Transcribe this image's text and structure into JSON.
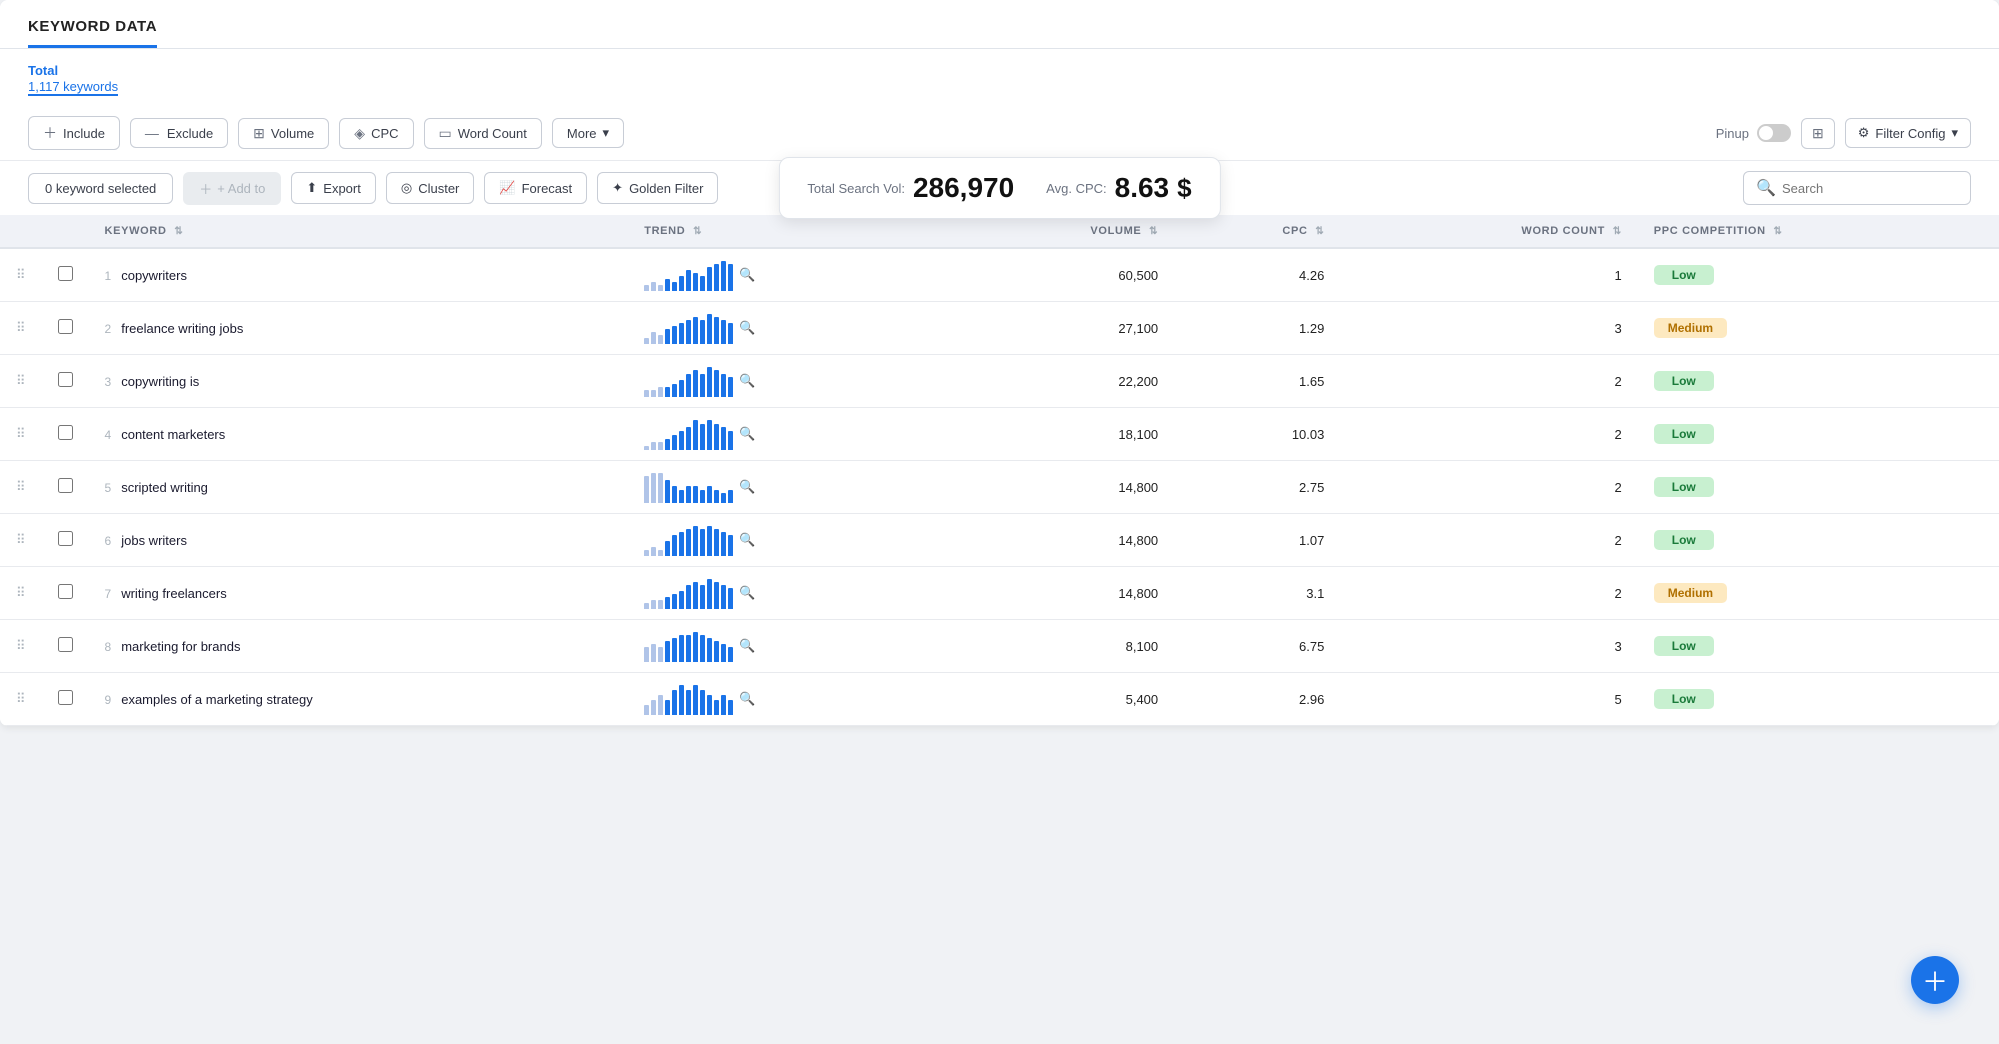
{
  "app": {
    "tab_title": "KEYWORD DATA"
  },
  "total": {
    "label": "Total",
    "count": "1,117 keywords"
  },
  "filters": {
    "include_label": "+ Include",
    "exclude_label": "— Exclude",
    "volume_label": "Volume",
    "cpc_label": "CPC",
    "word_count_label": "Word Count",
    "more_label": "More",
    "pinup_label": "Pinup",
    "filter_config_label": "Filter Config"
  },
  "actions": {
    "keyword_selected": "0 keyword selected",
    "add_to_label": "+ Add to",
    "export_label": "Export",
    "cluster_label": "Cluster",
    "forecast_label": "Forecast",
    "golden_filter_label": "Golden Filter",
    "search_placeholder": "Search"
  },
  "stats": {
    "total_search_vol_label": "Total Search Vol:",
    "total_search_vol_value": "286,970",
    "avg_cpc_label": "Avg. CPC:",
    "avg_cpc_value": "8.63",
    "avg_cpc_unit": "$"
  },
  "table": {
    "columns": [
      "",
      "",
      "KEYWORD",
      "TREND",
      "VOLUME",
      "CPC",
      "WORD COUNT",
      "PPC COMPETITION"
    ],
    "rows": [
      {
        "num": 1,
        "keyword": "copywriters",
        "volume": "60,500",
        "cpc": "4.26",
        "word_count": 1,
        "ppc": "Low",
        "ppc_class": "low",
        "trend": [
          2,
          3,
          2,
          4,
          3,
          5,
          7,
          6,
          5,
          8,
          9,
          10,
          9
        ]
      },
      {
        "num": 2,
        "keyword": "freelance writing jobs",
        "volume": "27,100",
        "cpc": "1.29",
        "word_count": 3,
        "ppc": "Medium",
        "ppc_class": "medium",
        "trend": [
          2,
          4,
          3,
          5,
          6,
          7,
          8,
          9,
          8,
          10,
          9,
          8,
          7
        ]
      },
      {
        "num": 3,
        "keyword": "copywriting is",
        "volume": "22,200",
        "cpc": "1.65",
        "word_count": 2,
        "ppc": "Low",
        "ppc_class": "low",
        "trend": [
          2,
          2,
          3,
          3,
          4,
          5,
          7,
          8,
          7,
          9,
          8,
          7,
          6
        ]
      },
      {
        "num": 4,
        "keyword": "content marketers",
        "volume": "18,100",
        "cpc": "10.03",
        "word_count": 2,
        "ppc": "Low",
        "ppc_class": "low",
        "trend": [
          1,
          2,
          2,
          3,
          4,
          5,
          6,
          8,
          7,
          8,
          7,
          6,
          5
        ]
      },
      {
        "num": 5,
        "keyword": "scripted writing",
        "volume": "14,800",
        "cpc": "2.75",
        "word_count": 2,
        "ppc": "Low",
        "ppc_class": "low",
        "trend": [
          8,
          9,
          9,
          7,
          5,
          4,
          5,
          5,
          4,
          5,
          4,
          3,
          4
        ]
      },
      {
        "num": 6,
        "keyword": "jobs writers",
        "volume": "14,800",
        "cpc": "1.07",
        "word_count": 2,
        "ppc": "Low",
        "ppc_class": "low",
        "trend": [
          2,
          3,
          2,
          5,
          7,
          8,
          9,
          10,
          9,
          10,
          9,
          8,
          7
        ]
      },
      {
        "num": 7,
        "keyword": "writing freelancers",
        "volume": "14,800",
        "cpc": "3.1",
        "word_count": 2,
        "ppc": "Medium",
        "ppc_class": "medium",
        "trend": [
          2,
          3,
          3,
          4,
          5,
          6,
          8,
          9,
          8,
          10,
          9,
          8,
          7
        ]
      },
      {
        "num": 8,
        "keyword": "marketing for brands",
        "volume": "8,100",
        "cpc": "6.75",
        "word_count": 3,
        "ppc": "Low",
        "ppc_class": "low",
        "trend": [
          5,
          6,
          5,
          7,
          8,
          9,
          9,
          10,
          9,
          8,
          7,
          6,
          5
        ]
      },
      {
        "num": 9,
        "keyword": "examples of a marketing strategy",
        "volume": "5,400",
        "cpc": "2.96",
        "word_count": 5,
        "ppc": "Low",
        "ppc_class": "low",
        "trend": [
          2,
          3,
          4,
          3,
          5,
          6,
          5,
          6,
          5,
          4,
          3,
          4,
          3
        ]
      }
    ]
  }
}
